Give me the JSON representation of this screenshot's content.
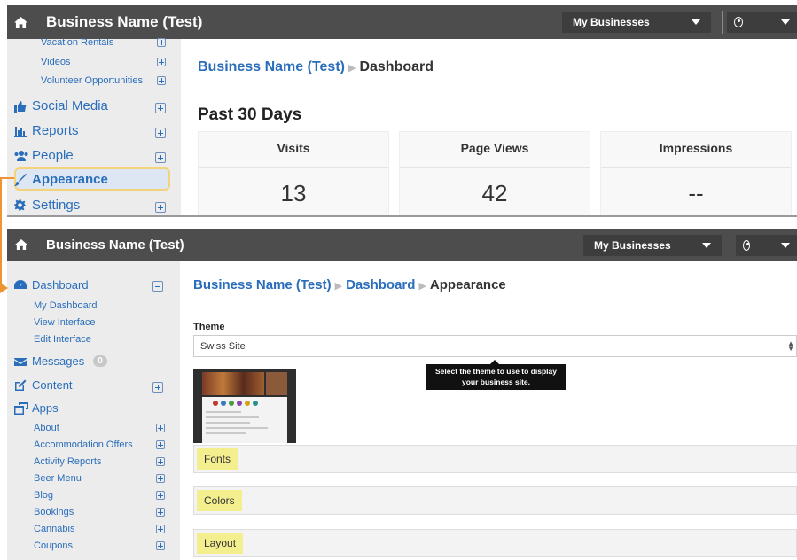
{
  "top": {
    "brand": "Business Name (Test)",
    "my_businesses": "My Businesses",
    "sidebar": {
      "sub_items": [
        {
          "label": "Vacation Rentals"
        },
        {
          "label": "Videos"
        },
        {
          "label": "Volunteer Opportunities"
        }
      ],
      "items": [
        {
          "label": "Social Media",
          "icon": "thumbs-up-icon"
        },
        {
          "label": "Reports",
          "icon": "bar-chart-icon"
        },
        {
          "label": "People",
          "icon": "users-icon"
        },
        {
          "label": "Appearance",
          "icon": "paint-brush-icon"
        },
        {
          "label": "Settings",
          "icon": "gear-icon"
        }
      ]
    },
    "breadcrumb": {
      "link": "Business Name (Test)",
      "current": "Dashboard"
    },
    "heading": "Past 30 Days",
    "stats": [
      {
        "title": "Visits",
        "value": "13"
      },
      {
        "title": "Page Views",
        "value": "42"
      },
      {
        "title": "Impressions",
        "value": "--"
      }
    ]
  },
  "bottom": {
    "brand": "Business Name (Test)",
    "my_businesses": "My Businesses",
    "sidebar": {
      "dashboard": {
        "label": "Dashboard",
        "icon": "dashboard-icon"
      },
      "dashboard_sub": [
        "My Dashboard",
        "View Interface",
        "Edit Interface"
      ],
      "messages": {
        "label": "Messages",
        "badge": "0",
        "icon": "envelope-icon"
      },
      "content": {
        "label": "Content",
        "icon": "edit-icon"
      },
      "apps": {
        "label": "Apps",
        "icon": "windows-icon"
      },
      "app_items": [
        "About",
        "Accommodation Offers",
        "Activity Reports",
        "Beer Menu",
        "Blog",
        "Bookings",
        "Cannabis",
        "Coupons"
      ]
    },
    "breadcrumb": {
      "link1": "Business Name (Test)",
      "link2": "Dashboard",
      "current": "Appearance"
    },
    "theme_label": "Theme",
    "theme_value": "Swiss Site",
    "tooltip": "Select the theme to use to display your business site.",
    "sections": [
      "Fonts",
      "Colors",
      "Layout"
    ]
  },
  "colors": {
    "link": "#2a6ebb",
    "topbar": "#4d4d4d",
    "highlight": "#f4ef8e",
    "arrow": "#ee9430"
  }
}
